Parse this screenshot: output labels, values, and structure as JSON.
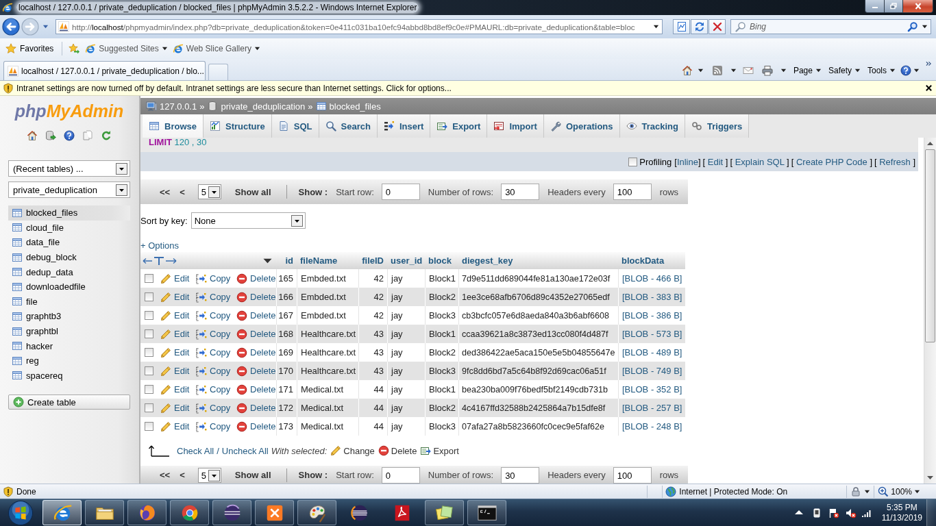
{
  "browser": {
    "title": "localhost / 127.0.0.1 / private_deduplication / blocked_files | phpMyAdmin 3.5.2.2 - Windows Internet Explorer",
    "address": {
      "scheme": "http://",
      "host": "localhost",
      "path": "/phpmyadmin/index.php?db=private_deduplication&token=0e411c031ba10efc94abbd8bd8ef9c0e#PMAURL:db=private_deduplication&table=bloc"
    },
    "search": {
      "placeholder": "Bing"
    },
    "favorites": {
      "label": "Favorites",
      "links": [
        "Suggested Sites",
        "Web Slice Gallery"
      ]
    },
    "tabs": [
      {
        "label": "localhost / 127.0.0.1 / private_deduplication / blo...",
        "selected": true
      }
    ],
    "command_bar": [
      "Page",
      "Safety",
      "Tools"
    ],
    "info_bar": "Intranet settings are now turned off by default. Intranet settings are less secure than Internet settings. Click for options..."
  },
  "sidebar": {
    "logo": [
      "php",
      "MyAdmin"
    ],
    "recent_tables": "(Recent tables) ...",
    "database": "private_deduplication",
    "tables": [
      {
        "name": "blocked_files",
        "selected": true
      },
      {
        "name": "cloud_file",
        "selected": false
      },
      {
        "name": "data_file",
        "selected": false
      },
      {
        "name": "debug_block",
        "selected": false
      },
      {
        "name": "dedup_data",
        "selected": false
      },
      {
        "name": "downloadedfile",
        "selected": false
      },
      {
        "name": "file",
        "selected": false
      },
      {
        "name": "graphtb3",
        "selected": false
      },
      {
        "name": "graphtbl",
        "selected": false
      },
      {
        "name": "hacker",
        "selected": false
      },
      {
        "name": "reg",
        "selected": false
      },
      {
        "name": "spacereq",
        "selected": false
      }
    ],
    "create_button": "Create table"
  },
  "main": {
    "breadcrumb": {
      "separator": "»",
      "items": [
        "127.0.0.1",
        "private_deduplication",
        "blocked_files"
      ]
    },
    "tabs": [
      {
        "label": "Browse",
        "selected": true
      },
      {
        "label": "Structure",
        "selected": false
      },
      {
        "label": "SQL",
        "selected": false
      },
      {
        "label": "Search",
        "selected": false
      },
      {
        "label": "Insert",
        "selected": false
      },
      {
        "label": "Export",
        "selected": false
      },
      {
        "label": "Import",
        "selected": false
      },
      {
        "label": "Operations",
        "selected": false
      },
      {
        "label": "Tracking",
        "selected": false
      },
      {
        "label": "Triggers",
        "selected": false
      }
    ],
    "query": {
      "keyword": "LIMIT",
      "args": "120 , 30"
    },
    "profiling": {
      "label": "Profiling",
      "checked": false,
      "links": [
        {
          "open": "[",
          "label": "Inline",
          "close": "]"
        },
        {
          "open": "[ ",
          "label": "Edit",
          "close": " ]"
        },
        {
          "open": "[ ",
          "label": "Explain SQL",
          "close": " ]"
        },
        {
          "open": "[ ",
          "label": "Create PHP Code",
          "close": " ]"
        },
        {
          "open": "[ ",
          "label": "Refresh",
          "close": " ]"
        }
      ]
    },
    "navigation": [
      {
        "first": "<<",
        "prev": "<",
        "page": "5",
        "show_all": "Show all",
        "show_label": "Show :",
        "start_label": "Start row:",
        "start": "0",
        "rows_label": "Number of rows:",
        "rows": "30",
        "headers_label": "Headers every",
        "headers": "100",
        "unit": "rows"
      },
      {
        "first": "<<",
        "prev": "<",
        "page": "5",
        "show_all": "Show all",
        "show_label": "Show :",
        "start_label": "Start row:",
        "start": "0",
        "rows_label": "Number of rows:",
        "rows": "30",
        "headers_label": "Headers every",
        "headers": "100",
        "unit": "rows"
      }
    ],
    "sort": {
      "label": "Sort by key:",
      "value": "None"
    },
    "options_link": "+ Options",
    "table": {
      "columns": [
        "id",
        "fileName",
        "fileID",
        "user_id",
        "block",
        "diegest_key",
        "blockData"
      ],
      "rows": [
        {
          "checked": false,
          "actions": [
            "Edit",
            "Copy",
            "Delete"
          ],
          "cells": [
            "165",
            "Embded.txt",
            "42",
            "jay",
            "Block1",
            "7d9e511dd689044fe81a130ae172e03f",
            "[BLOB - 466 B]"
          ]
        },
        {
          "checked": false,
          "actions": [
            "Edit",
            "Copy",
            "Delete"
          ],
          "cells": [
            "166",
            "Embded.txt",
            "42",
            "jay",
            "Block2",
            "1ee3ce68afb6706d89c4352e27065edf",
            "[BLOB - 383 B]"
          ]
        },
        {
          "checked": false,
          "actions": [
            "Edit",
            "Copy",
            "Delete"
          ],
          "cells": [
            "167",
            "Embded.txt",
            "42",
            "jay",
            "Block3",
            "cb3bcfc057e6d8aeda840a3b6abf6608",
            "[BLOB - 386 B]"
          ]
        },
        {
          "checked": false,
          "actions": [
            "Edit",
            "Copy",
            "Delete"
          ],
          "cells": [
            "168",
            "Healthcare.txt",
            "43",
            "jay",
            "Block1",
            "ccaa39621a8c3873ed13cc080f4d487f",
            "[BLOB - 573 B]"
          ]
        },
        {
          "checked": false,
          "actions": [
            "Edit",
            "Copy",
            "Delete"
          ],
          "cells": [
            "169",
            "Healthcare.txt",
            "43",
            "jay",
            "Block2",
            "ded386422ae5aca150e5e5b04855647e",
            "[BLOB - 489 B]"
          ]
        },
        {
          "checked": false,
          "actions": [
            "Edit",
            "Copy",
            "Delete"
          ],
          "cells": [
            "170",
            "Healthcare.txt",
            "43",
            "jay",
            "Block3",
            "9fc8dd6bd7a5c64b8f92d69cac06a51f",
            "[BLOB - 749 B]"
          ]
        },
        {
          "checked": false,
          "actions": [
            "Edit",
            "Copy",
            "Delete"
          ],
          "cells": [
            "171",
            "Medical.txt",
            "44",
            "jay",
            "Block1",
            "bea230ba009f76bedf5bf2149cdb731b",
            "[BLOB - 352 B]"
          ]
        },
        {
          "checked": false,
          "actions": [
            "Edit",
            "Copy",
            "Delete"
          ],
          "cells": [
            "172",
            "Medical.txt",
            "44",
            "jay",
            "Block2",
            "4c4167ffd32588b2425864a7b15dfe8f",
            "[BLOB - 257 B]"
          ]
        },
        {
          "checked": false,
          "actions": [
            "Edit",
            "Copy",
            "Delete"
          ],
          "cells": [
            "173",
            "Medical.txt",
            "44",
            "jay",
            "Block3",
            "07afa27a8b5823660fc0cec9e5faf62e",
            "[BLOB - 248 B]"
          ]
        }
      ]
    },
    "footer": {
      "check_all": "Check All",
      "separator": "/",
      "uncheck_all": "Uncheck All",
      "with_selected": "With selected:",
      "actions": [
        "Change",
        "Delete",
        "Export"
      ]
    }
  },
  "status_bar": {
    "status": "Done",
    "zone": "Internet | Protected Mode: On",
    "zoom": "100%"
  },
  "taskbar": {
    "apps": [
      {
        "running": true,
        "selected": true
      },
      {
        "running": true,
        "selected": false
      },
      {
        "running": true,
        "selected": false
      },
      {
        "running": true,
        "selected": false
      },
      {
        "running": true,
        "selected": false
      },
      {
        "running": true,
        "selected": false
      },
      {
        "running": true,
        "selected": false
      },
      {
        "running": false,
        "selected": false
      },
      {
        "running": false,
        "selected": false
      },
      {
        "running": true,
        "selected": false
      },
      {
        "running": true,
        "selected": false
      }
    ],
    "time": "5:35 PM",
    "date": "11/13/2019"
  }
}
